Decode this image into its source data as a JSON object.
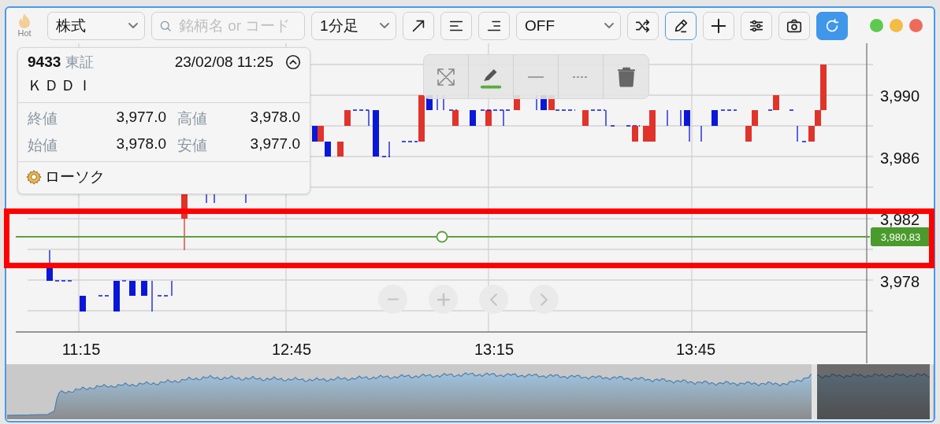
{
  "toolbar": {
    "items": [
      {
        "kind": "hot",
        "label": "Hot"
      },
      {
        "kind": "select",
        "value": "株式"
      },
      {
        "kind": "search",
        "placeholder": "銘柄名 or コード"
      },
      {
        "kind": "select",
        "value": "1分足"
      },
      {
        "kind": "trend",
        "selected": false
      },
      {
        "kind": "bars-left",
        "selected": false
      },
      {
        "kind": "bars-right",
        "selected": false
      },
      {
        "kind": "select",
        "value": "OFF"
      },
      {
        "kind": "shuffle",
        "selected": false
      },
      {
        "kind": "pencil",
        "selected": true
      },
      {
        "kind": "crosshair",
        "selected": false
      },
      {
        "kind": "sliders",
        "selected": false
      },
      {
        "kind": "camera",
        "selected": false
      },
      {
        "kind": "refresh"
      }
    ],
    "window_controls": [
      {
        "color": "#5ec94f"
      },
      {
        "color": "#f4bc44"
      },
      {
        "color": "#ee6a5b"
      }
    ]
  },
  "info_panel": {
    "code": "9433",
    "exchange": "東証",
    "datetime": "23/02/08 11:25",
    "expanded": true,
    "name": "ＫＤＤＩ",
    "fields": [
      {
        "label": "終値",
        "value": "3,977.0"
      },
      {
        "label": "高値",
        "value": "3,978.0"
      },
      {
        "label": "始値",
        "value": "3,978.0"
      },
      {
        "label": "安値",
        "value": "3,977.0"
      }
    ],
    "chart_type": "ローソク"
  },
  "draw_toolbar": {
    "tools": [
      {
        "kind": "expand"
      },
      {
        "kind": "pencil"
      },
      {
        "kind": "solid-line"
      },
      {
        "kind": "dashed-line"
      },
      {
        "kind": "trash"
      }
    ]
  },
  "price_axis": {
    "ticks": [
      "3,990",
      "3,986",
      "3,982",
      "3,978"
    ]
  },
  "price_line": {
    "label": "3,980.83"
  },
  "time_axis": {
    "ticks": [
      "11:15",
      "12:45",
      "13:15",
      "13:45"
    ]
  },
  "nav_controls": [
    {
      "kind": "zoom-out"
    },
    {
      "kind": "zoom-in"
    },
    {
      "kind": "prev"
    },
    {
      "kind": "next"
    }
  ]
}
